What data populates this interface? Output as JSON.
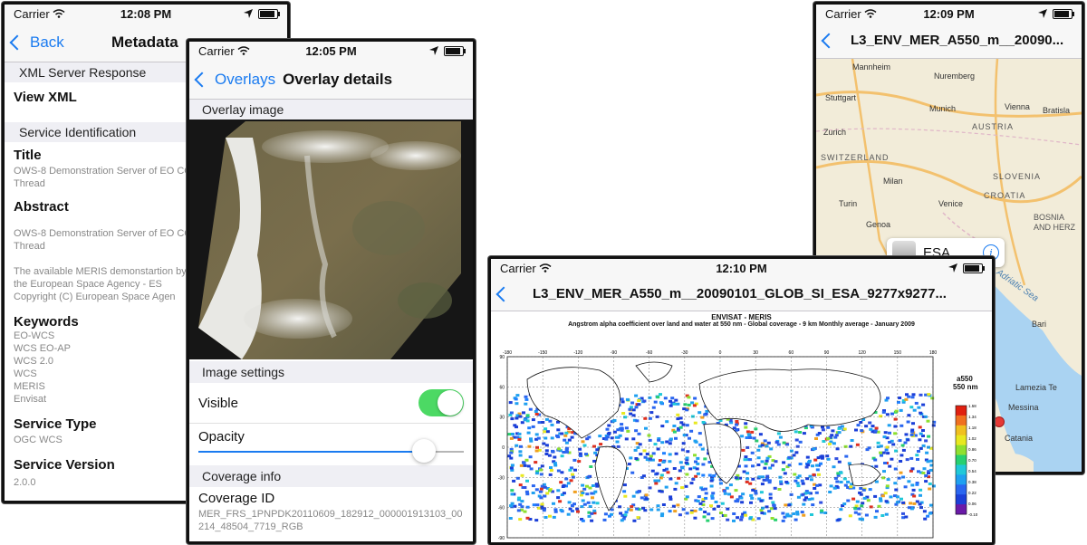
{
  "colors": {
    "accent": "#1a7bf0",
    "toggle_on": "#4cd964",
    "pin": "#e53935"
  },
  "phone1": {
    "status": {
      "carrier": "Carrier",
      "time": "12:08 PM"
    },
    "nav": {
      "back": "Back",
      "title": "Metadata"
    },
    "sections": {
      "xml": "XML Server Response",
      "service": "Service Identification"
    },
    "view_xml": "View XML",
    "title_label": "Title",
    "title_value": "OWS-8 Demonstration Server of EO CCI Thread",
    "abstract_label": "Abstract",
    "abstract_value1": "OWS-8 Demonstration Server of EO CCI Thread",
    "abstract_value2": "The available MERIS demonstartion by the European Space Agency - ES Copyright (C) European Space Agen",
    "keywords_label": "Keywords",
    "keywords": [
      "EO-WCS",
      "WCS EO-AP",
      "WCS 2.0",
      "WCS",
      "MERIS",
      "Envisat"
    ],
    "service_type_label": "Service Type",
    "service_type_value": "OGC WCS",
    "service_version_label": "Service Version",
    "service_version_value": "2.0.0"
  },
  "phone2": {
    "status": {
      "carrier": "Carrier",
      "time": "12:05 PM"
    },
    "nav": {
      "back": "Overlays",
      "title": "Overlay details"
    },
    "sections": {
      "image": "Overlay image",
      "settings": "Image settings",
      "coverage": "Coverage info"
    },
    "visible_label": "Visible",
    "visible_on": true,
    "opacity_label": "Opacity",
    "opacity_value": 0.85,
    "coverage_id_label": "Coverage ID",
    "coverage_id_value": "MER_FRS_1PNPDK20110609_182912_000001913103_00214_48504_7719_RGB"
  },
  "phone3": {
    "status": {
      "carrier": "Carrier",
      "time": "12:10 PM"
    },
    "nav": {
      "title": "L3_ENV_MER_A550_m__20090101_GLOB_SI_ESA_9277x9277..."
    },
    "map": {
      "title1": "ENVISAT - MERIS",
      "title2": "Angstrom alpha coefficient over land and water at 550 nm - Global coverage - 9 km Monthly average - January 2009",
      "legend_title": "a550",
      "legend_sub": "550 nm",
      "legend_ticks": [
        "1.58",
        "1.34",
        "1.18",
        "1.02",
        "0.86",
        "0.70",
        "0.54",
        "0.38",
        "0.22",
        "0.06",
        "-0.10"
      ],
      "lon_ticks": [
        "-180",
        "-150",
        "-120",
        "-90",
        "-60",
        "-30",
        "0",
        "30",
        "60",
        "90",
        "120",
        "150",
        "180"
      ],
      "lat_ticks": [
        "90",
        "60",
        "30",
        "0",
        "-30",
        "-60",
        "-90"
      ]
    }
  },
  "phone4": {
    "status": {
      "carrier": "Carrier",
      "time": "12:09 PM"
    },
    "nav": {
      "title": "L3_ENV_MER_A550_m__20090..."
    },
    "callout": "ESA",
    "cities": [
      "Mannheim",
      "Nuremberg",
      "Stuttgart",
      "Munich",
      "Vienna",
      "Bratisla",
      "Zurich",
      "AUSTRIA",
      "SWITZERLAND",
      "SLOVENIA",
      "Milan",
      "Venice",
      "Turin",
      "CROATIA",
      "Genoa",
      "BOSNIA AND HERZ",
      "Adriatic Sea",
      "Bari",
      "Lamezia Te",
      "Messina",
      "Catania"
    ]
  }
}
